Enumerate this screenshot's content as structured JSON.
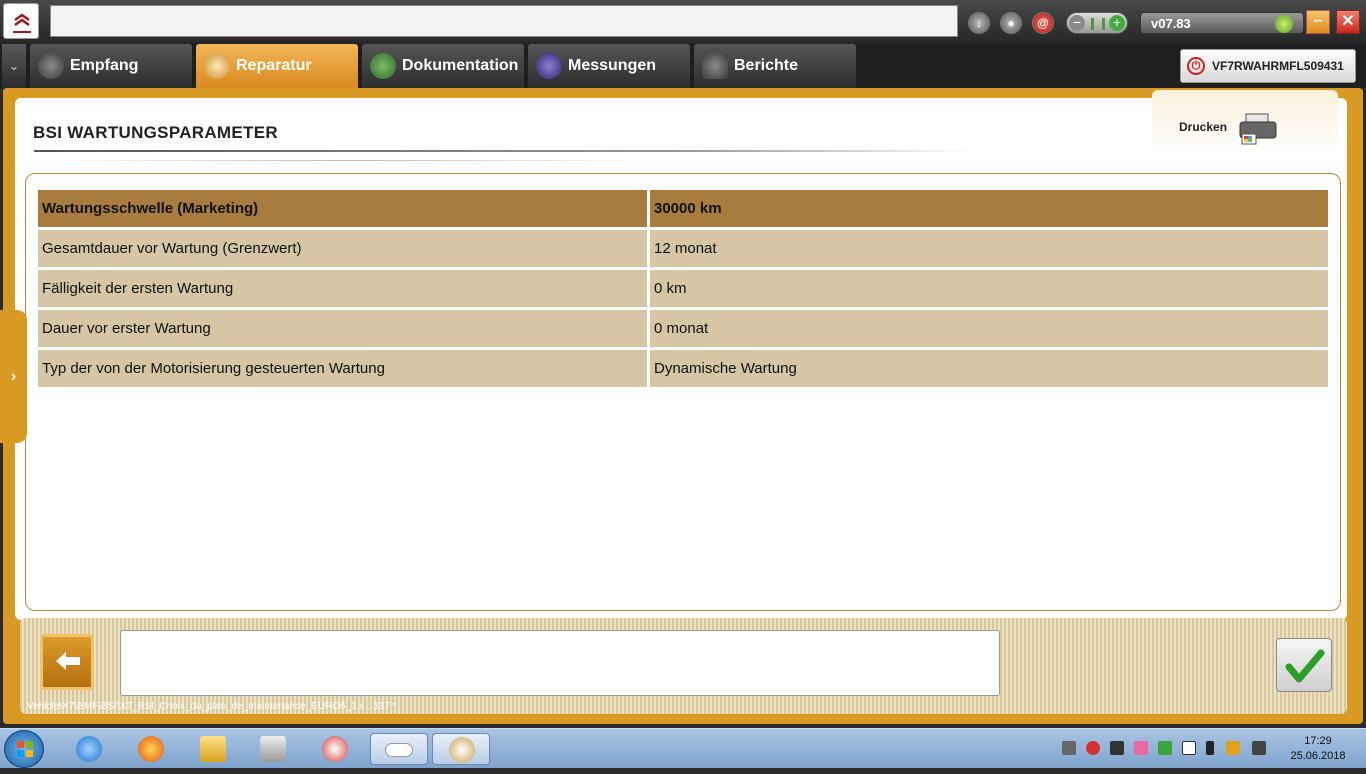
{
  "window": {
    "version": "v07.83",
    "vin": "VF7RWAHRMFL509431"
  },
  "tabs": [
    {
      "label": "Empfang",
      "icon": "speedometer-icon",
      "active": false
    },
    {
      "label": "Reparatur",
      "icon": "magnifier-icon",
      "active": true
    },
    {
      "label": "Dokumentation",
      "icon": "book-icon",
      "active": false
    },
    {
      "label": "Messungen",
      "icon": "oscilloscope-icon",
      "active": false
    },
    {
      "label": "Berichte",
      "icon": "report-icon",
      "active": false
    }
  ],
  "page": {
    "title": "BSI  WARTUNGSPARAMETER",
    "print_label": "Drucken"
  },
  "table": {
    "rows": [
      {
        "key": "Wartungsschwelle (Marketing)",
        "value": "30000 km"
      },
      {
        "key": "Gesamtdauer vor Wartung (Grenzwert)",
        "value": "12 monat"
      },
      {
        "key": "Fälligkeit der ersten Wartung",
        "value": "0 km"
      },
      {
        "key": "Dauer vor erster Wartung",
        "value": "0 monat"
      },
      {
        "key": "Typ der von der Motorisierung gesteuerten Wartung",
        "value": "Dynamische Wartung"
      }
    ]
  },
  "footer": {
    "path": "Vehicle\\X7\\BMF\\BSI\\X7_BSI_Choix_du_plan_de_maintenance_EURO6_1.s : 337 *",
    "message": ""
  },
  "taskbar": {
    "time": "17:29",
    "date": "25.06.2018"
  },
  "colors": {
    "accent": "#d99a24",
    "header_row": "#a87c3e",
    "row": "#d6c6a6",
    "taskbar": "#8fb0d8"
  }
}
